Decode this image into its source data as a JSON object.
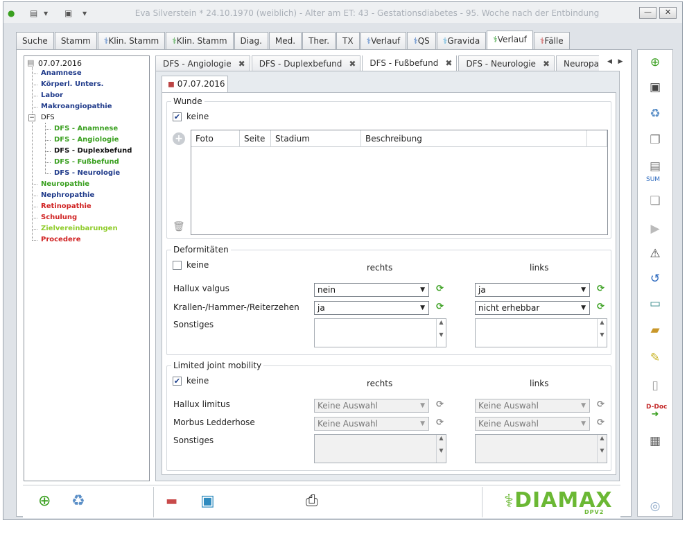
{
  "window": {
    "title": "Eva Silverstein  * 24.10.1970 (weiblich) - Alter am ET: 43 - Gestationsdiabetes - 95. Woche nach der Entbindung",
    "minimize_label": "—",
    "close_label": "✕"
  },
  "main_tabs": [
    {
      "label": "Suche",
      "icon": ""
    },
    {
      "label": "Stamm",
      "icon": ""
    },
    {
      "label": "Klin. Stamm",
      "icon": "caduceus-blue"
    },
    {
      "label": "Klin. Stamm",
      "icon": "caduceus-green"
    },
    {
      "label": "Diag.",
      "icon": ""
    },
    {
      "label": "Med.",
      "icon": ""
    },
    {
      "label": "Ther.",
      "icon": ""
    },
    {
      "label": "TX",
      "icon": ""
    },
    {
      "label": "Verlauf",
      "icon": "caduceus-blue"
    },
    {
      "label": "QS",
      "icon": "caduceus-blue"
    },
    {
      "label": "Gravida",
      "icon": "caduceus-lightblue"
    },
    {
      "label": "Verlauf",
      "icon": "caduceus-green"
    },
    {
      "label": "Fälle",
      "icon": "caduceus-red"
    }
  ],
  "tree": {
    "root": "07.07.2016",
    "items": [
      {
        "label": "Anamnese",
        "color": "blue"
      },
      {
        "label": "Körperl. Unters.",
        "color": "blue"
      },
      {
        "label": "Labor",
        "color": "blue"
      },
      {
        "label": "Makroangiopathie",
        "color": "blue"
      },
      {
        "label": "DFS",
        "color": "black"
      },
      {
        "label": "DFS - Anamnese",
        "color": "green"
      },
      {
        "label": "DFS - Angiologie",
        "color": "green"
      },
      {
        "label": "DFS - Duplexbefund",
        "color": "black"
      },
      {
        "label": "DFS - Fußbefund",
        "color": "green"
      },
      {
        "label": "DFS - Neurologie",
        "color": "blue"
      },
      {
        "label": "Neuropathie",
        "color": "green"
      },
      {
        "label": "Nephropathie",
        "color": "blue"
      },
      {
        "label": "Retinopathie",
        "color": "red"
      },
      {
        "label": "Schulung",
        "color": "red"
      },
      {
        "label": "Zielvereinbarungen",
        "color": "lime"
      },
      {
        "label": "Procedere",
        "color": "red"
      }
    ],
    "collapse_symbol": "−"
  },
  "sub_tabs": [
    {
      "label": "DFS - Angiologie",
      "close": "✖"
    },
    {
      "label": "DFS - Duplexbefund",
      "close": "✖"
    },
    {
      "label": "DFS - Fußbefund",
      "close": "✖"
    },
    {
      "label": "DFS - Neurologie",
      "close": "✖"
    },
    {
      "label": "Neuropathie",
      "close": ""
    }
  ],
  "date_tab": "07.07.2016",
  "wunde": {
    "title": "Wunde",
    "keine_label": "keine",
    "keine_checked": "✔",
    "columns": [
      "Foto",
      "Seite",
      "Stadium",
      "Beschreibung"
    ]
  },
  "deformitaeten": {
    "title": "Deformitäten",
    "keine_label": "keine",
    "rechts": "rechts",
    "links": "links",
    "rows": [
      {
        "label": "Hallux valgus",
        "rechts": "nein",
        "links": "ja"
      },
      {
        "label": "Krallen-/Hammer-/Reiterzehen",
        "rechts": "ja",
        "links": "nicht erhebbar"
      }
    ],
    "sonstiges_label": "Sonstiges"
  },
  "mobility": {
    "title": "Limited joint mobility",
    "keine_label": "keine",
    "keine_checked": "✔",
    "rechts": "rechts",
    "links": "links",
    "rows": [
      {
        "label": "Hallux limitus",
        "rechts": "Keine Auswahl",
        "links": "Keine Auswahl"
      },
      {
        "label": "Morbus Ledderhose",
        "rechts": "Keine Auswahl",
        "links": "Keine Auswahl"
      }
    ],
    "sonstiges_label": "Sonstiges"
  },
  "right_toolbar": {
    "sum_label": "SUM",
    "ddoc_label": "D-Doc"
  },
  "logo": {
    "text": "DIAMAX",
    "sub": "DPV2"
  },
  "colors": {
    "accent_green": "#3aa020",
    "tree_blue": "#1f3a8a",
    "tree_red": "#d02222",
    "logo_green": "#6bb834"
  }
}
